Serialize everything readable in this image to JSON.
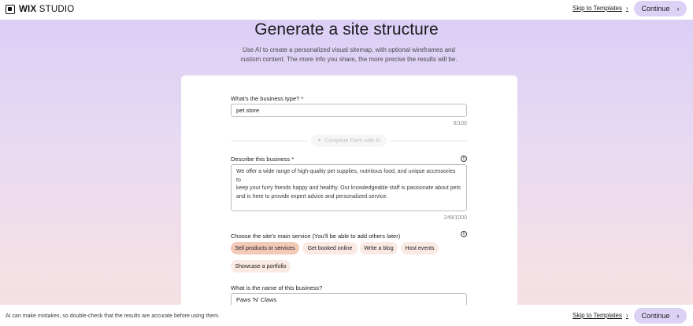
{
  "header": {
    "brand_bold": "WIX",
    "brand_light": "STUDIO",
    "skip_label": "Skip to Templates",
    "continue_label": "Continue"
  },
  "main": {
    "title": "Generate a site structure",
    "subtitle_line1": "Use AI to create a personalized visual sitemap, with optional wireframes and",
    "subtitle_line2": "custom content. The more info you share, the more precise the results will be."
  },
  "form": {
    "business_type": {
      "label": "What's the business type?",
      "required_mark": "*",
      "value": "pet store",
      "counter": "0/100"
    },
    "ai_button_label": "Complete Form with AI",
    "description": {
      "label": "Describe this business",
      "required_mark": "*",
      "line1": "We offer a wide range of high-quality pet supplies, nutritious food, and unique accessories to",
      "line2": "keep your furry friends happy and healthy. Our knowledgeable staff is passionate about pets",
      "line3": "and is here to provide expert advice and personalized service.",
      "counter": "249/1000"
    },
    "main_service": {
      "label": "Choose the site's main service (You'll be able to add others later)",
      "options": [
        {
          "label": "Sell products or services",
          "selected": true
        },
        {
          "label": "Get booked online",
          "selected": false
        },
        {
          "label": "Write a blog",
          "selected": false
        },
        {
          "label": "Host events",
          "selected": false
        },
        {
          "label": "Showcase a portfolio",
          "selected": false
        }
      ]
    },
    "business_name": {
      "label": "What is the name of this business?",
      "value": "Paws 'N' Claws"
    }
  },
  "footer": {
    "disclaimer": "AI can make mistakes, so double-check that the results are accurate before using them.",
    "skip_label": "Skip to Templates",
    "continue_label": "Continue"
  },
  "icons": {
    "chevron": "chevron-right-icon",
    "sparkle": "sparkle-icon",
    "info": "info-icon"
  },
  "colors": {
    "accent": "#dcd2f5",
    "chip": "#fbe9e4",
    "chip_selected": "#f3c9b8"
  }
}
